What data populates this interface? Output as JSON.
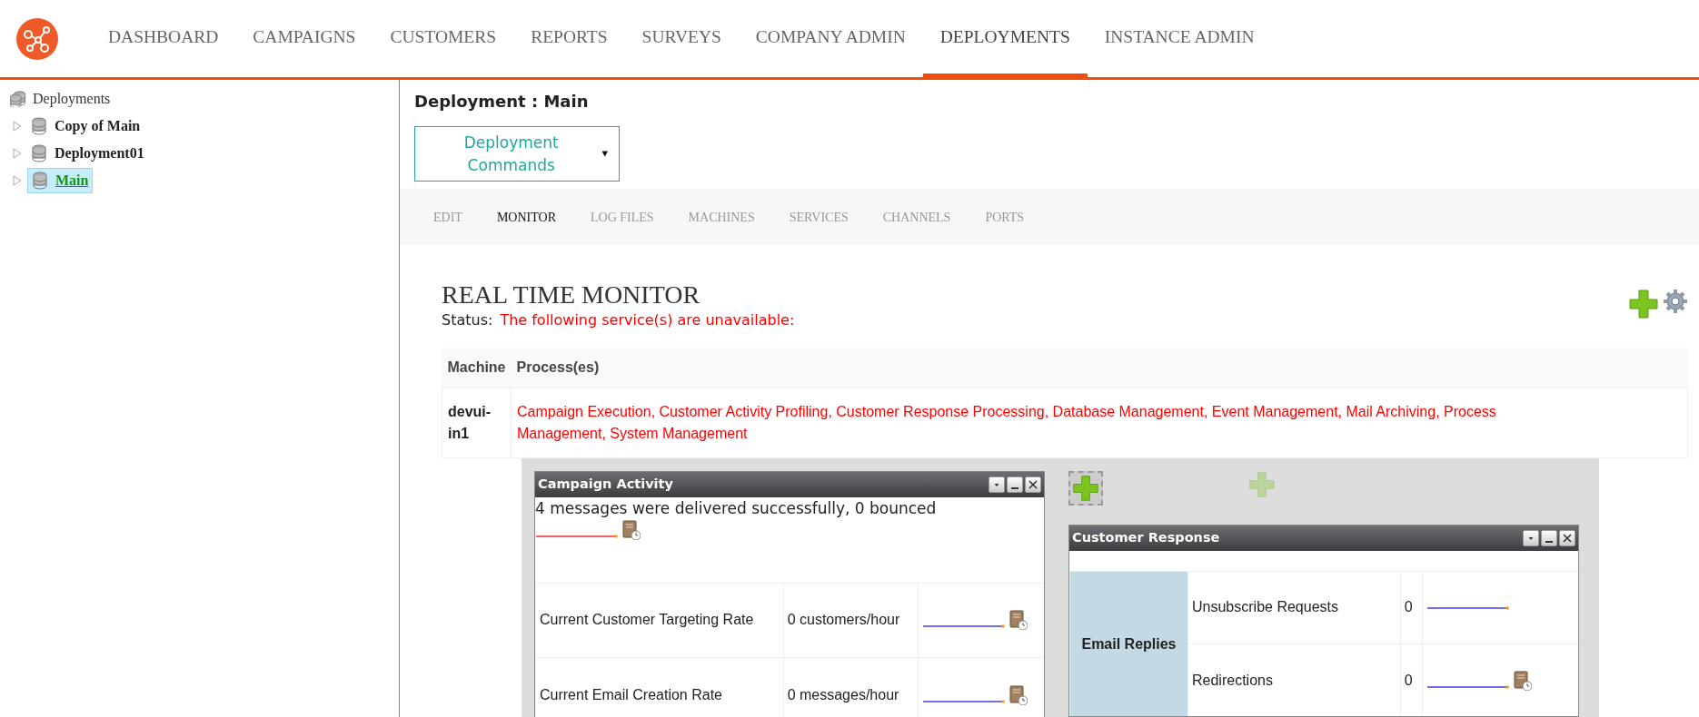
{
  "nav": {
    "items": [
      {
        "label": "DASHBOARD",
        "selected": false
      },
      {
        "label": "CAMPAIGNS",
        "selected": false
      },
      {
        "label": "CUSTOMERS",
        "selected": false
      },
      {
        "label": "REPORTS",
        "selected": false
      },
      {
        "label": "SURVEYS",
        "selected": false
      },
      {
        "label": "COMPANY ADMIN",
        "selected": false
      },
      {
        "label": "DEPLOYMENTS",
        "selected": true
      },
      {
        "label": "INSTANCE ADMIN",
        "selected": false
      }
    ]
  },
  "tree": {
    "root": "Deployments",
    "items": [
      {
        "label": "Copy of Main",
        "selected": false
      },
      {
        "label": "Deployment01",
        "selected": false
      },
      {
        "label": "Main",
        "selected": true
      }
    ]
  },
  "deployment": {
    "title": "Deployment : Main",
    "commands_button": "Deployment Commands",
    "caret": "▾"
  },
  "tabs": [
    {
      "label": "EDIT",
      "selected": false
    },
    {
      "label": "MONITOR",
      "selected": true
    },
    {
      "label": "LOG FILES",
      "selected": false
    },
    {
      "label": "MACHINES",
      "selected": false
    },
    {
      "label": "SERVICES",
      "selected": false
    },
    {
      "label": "CHANNELS",
      "selected": false
    },
    {
      "label": "PORTS",
      "selected": false
    }
  ],
  "monitor": {
    "title": "REAL TIME MONITOR",
    "status_label": "Status:",
    "status_message": "The following service(s) are unavailable:",
    "table": {
      "columns": [
        "Machine",
        "Process(es)"
      ],
      "rows": [
        {
          "machine": "devui-in1",
          "processes": "Campaign Execution, Customer Activity Profiling, Customer Response Processing, Database Management, Event Management, Mail Archiving, Process Management, System Management"
        }
      ]
    }
  },
  "widgets": {
    "campaign_activity": {
      "title": "Campaign Activity",
      "summary": "4 messages were delivered successfully, 0 bounced",
      "metrics": [
        {
          "label": "Current Customer Targeting Rate",
          "value": "0 customers/hour",
          "report": true
        },
        {
          "label": "Current Email Creation Rate",
          "value": "0 messages/hour",
          "report": true
        }
      ]
    },
    "customer_response": {
      "title": "Customer Response",
      "group": "Email Replies",
      "metrics": [
        {
          "label": "Unsubscribe Requests",
          "value": "0",
          "report": false
        },
        {
          "label": "Redirections",
          "value": "0",
          "report": true
        }
      ]
    }
  }
}
